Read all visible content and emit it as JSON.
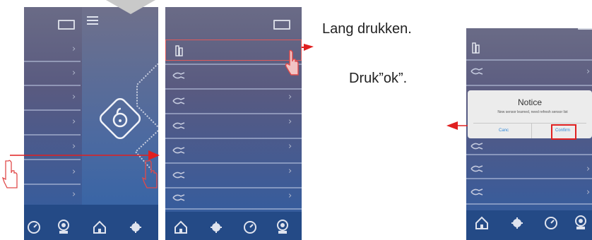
{
  "captions": {
    "long_press": "Lang drukken.",
    "press_ok": "Druk”ok”."
  },
  "dialog": {
    "title": "Notice",
    "message": "New sensor learned, need refresh sensor list",
    "cancel_label": "Canc",
    "confirm_label": "Confirm"
  },
  "icons": {
    "home": "home-icon",
    "sensor": "sensor-icon",
    "gauge": "gauge-icon",
    "camera": "camera-icon",
    "menu": "menu-icon",
    "unlock": "unlock-icon",
    "window": "window-icon",
    "device": "device-icon",
    "door_sensor": "door-sensor-icon",
    "tap_hand": "tap-hand-icon"
  },
  "colors": {
    "accent_red": "#e02020",
    "panel_top": "#6a6b86",
    "panel_bottom": "#2e5ea2",
    "bottom_bar": "#244a86",
    "dialog_link": "#2d86d8"
  }
}
